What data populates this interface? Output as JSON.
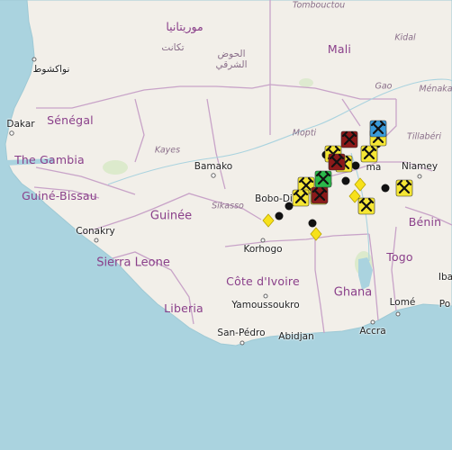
{
  "map": {
    "labels": {
      "mauritania": "موريتانيا",
      "tagant": "تكانت",
      "hodh_ech_chargui_1": "الحوض",
      "hodh_ech_chargui_2": "الشرقي",
      "nouakchott": "نواكشوط",
      "dakar": "Dakar",
      "senegal": "Sénégal",
      "the_gambia": "The Gambia",
      "guinea_bissau": "Guiné-Bissau",
      "conakry": "Conakry",
      "sierra_leone": "Sierra Leone",
      "liberia": "Liberia",
      "kayes": "Kayes",
      "bamako": "Bamako",
      "guinee": "Guinée",
      "sikasso": "Sikasso",
      "bobo": "Bobo-Di",
      "korhogo": "Korhogo",
      "cote_divoire": "Côte d'Ivoire",
      "yamoussoukro": "Yamoussoukro",
      "san_pedro": "San-Pédro",
      "abidjan": "Abidjan",
      "ghana": "Ghana",
      "accra": "Accra",
      "togo": "Togo",
      "lome": "Lomé",
      "benin": "Bénin",
      "niamey": "Niamey",
      "tillaberi": "Tillabéri",
      "mopti": "Mopti",
      "mali": "Mali",
      "kidal": "Kidal",
      "gao": "Gao",
      "menaka": "Ménaka",
      "tombouctou": "Tombouctou",
      "ouaga_fragment": "ma",
      "ba_fragment": "Iba",
      "po_fragment": "Po"
    },
    "colors": {
      "water": "#aad3df",
      "land": "#f2efe9",
      "land_sahel": "#f4f1e9",
      "vegetation": "#d6e8c4",
      "border": "#c8a3c8",
      "coast_stroke": "#9ec9d5",
      "mine_yellow": "#f5e634",
      "mine_red": "#8b1a1a",
      "mine_blue": "#3a9ad9",
      "mine_green": "#2bb84a",
      "site_black": "#111111",
      "site_diamond": "#f7e11a"
    },
    "markers": [
      {
        "kind": "mine-yellow"
      },
      {
        "kind": "mine-yellow"
      },
      {
        "kind": "mine-yellow"
      },
      {
        "kind": "mine-yellow"
      },
      {
        "kind": "mine-yellow"
      },
      {
        "kind": "mine-yellow"
      },
      {
        "kind": "mine-yellow"
      },
      {
        "kind": "mine-yellow"
      },
      {
        "kind": "mine-yellow"
      },
      {
        "kind": "mine-red"
      },
      {
        "kind": "mine-red"
      },
      {
        "kind": "mine-red"
      },
      {
        "kind": "mine-blue"
      },
      {
        "kind": "mine-green"
      }
    ]
  }
}
